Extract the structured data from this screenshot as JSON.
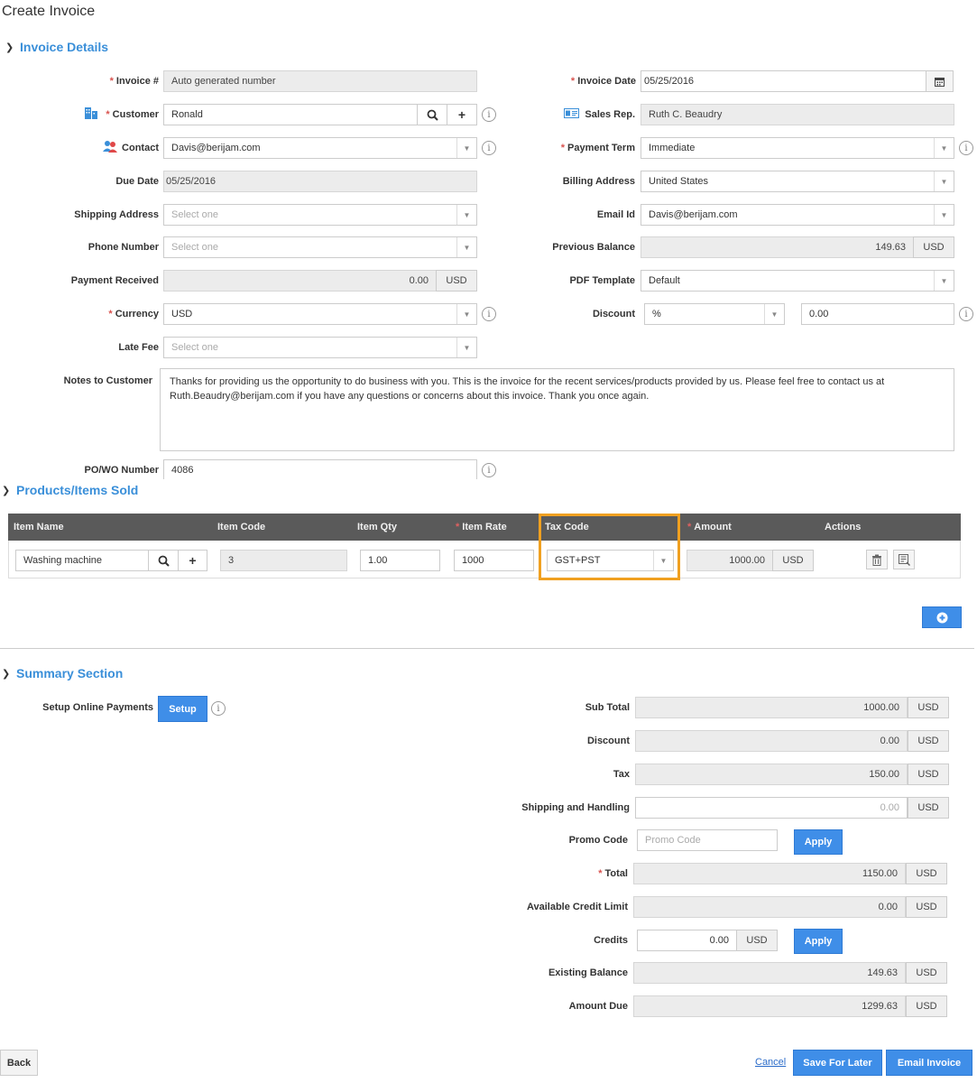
{
  "page": {
    "title": "Create Invoice"
  },
  "sections": {
    "invoice_details": "Invoice Details",
    "products": "Products/Items Sold",
    "summary": "Summary Section"
  },
  "left_fields": {
    "invoice_no": {
      "label": "Invoice #",
      "value": "Auto generated number"
    },
    "customer": {
      "label": "Customer",
      "value": "Ronald"
    },
    "contact": {
      "label": "Contact",
      "value": "Davis@berijam.com"
    },
    "due_date": {
      "label": "Due Date",
      "value": "05/25/2016"
    },
    "shipping_address": {
      "label": "Shipping Address",
      "placeholder": "Select one"
    },
    "phone_number": {
      "label": "Phone Number",
      "placeholder": "Select one"
    },
    "payment_received": {
      "label": "Payment Received",
      "value": "0.00",
      "unit": "USD"
    },
    "currency": {
      "label": "Currency",
      "value": "USD"
    },
    "late_fee": {
      "label": "Late Fee",
      "placeholder": "Select one"
    },
    "notes": {
      "label": "Notes to Customer",
      "value": "Thanks for providing us the opportunity to do business with you. This is the invoice for the recent services/products provided by us. Please feel free to contact us at Ruth.Beaudry@berijam.com if you have any questions or concerns about this invoice. Thank you once again."
    },
    "po_number": {
      "label": "PO/WO Number",
      "value": "4086"
    }
  },
  "right_fields": {
    "invoice_date": {
      "label": "Invoice Date",
      "value": "05/25/2016"
    },
    "sales_rep": {
      "label": "Sales Rep.",
      "value": "Ruth C. Beaudry"
    },
    "payment_term": {
      "label": "Payment Term",
      "value": "Immediate"
    },
    "billing_address": {
      "label": "Billing Address",
      "value": "United States"
    },
    "email_id": {
      "label": "Email Id",
      "value": "Davis@berijam.com"
    },
    "previous_balance": {
      "label": "Previous Balance",
      "value": "149.63",
      "unit": "USD"
    },
    "pdf_template": {
      "label": "PDF Template",
      "value": "Default"
    },
    "discount": {
      "label": "Discount",
      "type": "%",
      "value": "0.00"
    }
  },
  "table": {
    "headers": {
      "item_name": "Item Name",
      "item_code": "Item Code",
      "item_qty": "Item Qty",
      "item_rate": "Item Rate",
      "tax_code": "Tax Code",
      "amount": "Amount",
      "actions": "Actions"
    },
    "row": {
      "item_name": "Washing machine",
      "item_code": "3",
      "item_qty": "1.00",
      "item_rate": "1000",
      "tax_code": "GST+PST",
      "amount": "1000.00",
      "unit": "USD"
    }
  },
  "summary": {
    "setup_online": {
      "label": "Setup Online Payments",
      "button": "Setup"
    },
    "sub_total": {
      "label": "Sub Total",
      "value": "1000.00",
      "unit": "USD"
    },
    "discount": {
      "label": "Discount",
      "value": "0.00",
      "unit": "USD"
    },
    "tax": {
      "label": "Tax",
      "value": "150.00",
      "unit": "USD"
    },
    "shipping": {
      "label": "Shipping and Handling",
      "value": "0.00",
      "unit": "USD"
    },
    "promo": {
      "label": "Promo Code",
      "placeholder": "Promo Code",
      "button": "Apply"
    },
    "total": {
      "label": "Total",
      "value": "1150.00",
      "unit": "USD"
    },
    "credit_limit": {
      "label": "Available Credit Limit",
      "value": "0.00",
      "unit": "USD"
    },
    "credits": {
      "label": "Credits",
      "value": "0.00",
      "unit": "USD",
      "button": "Apply"
    },
    "existing_balance": {
      "label": "Existing Balance",
      "value": "149.63",
      "unit": "USD"
    },
    "amount_due": {
      "label": "Amount Due",
      "value": "1299.63",
      "unit": "USD"
    }
  },
  "footer": {
    "back": "Back",
    "cancel": "Cancel",
    "save_later": "Save For Later",
    "email_invoice": "Email Invoice"
  },
  "colors": {
    "accent": "#3f8ee8",
    "highlight": "#f0a020",
    "header_bg": "#5a5a5a"
  }
}
